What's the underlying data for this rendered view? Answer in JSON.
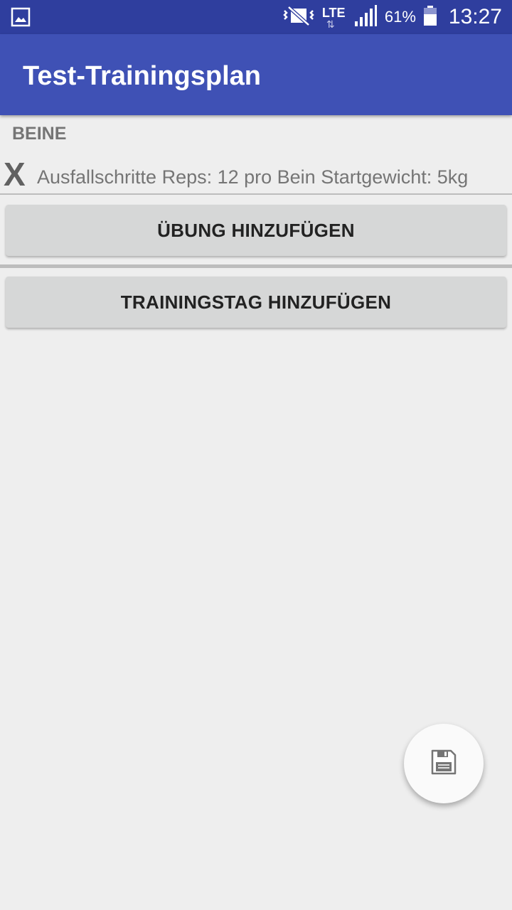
{
  "status_bar": {
    "battery_percent": "61%",
    "time": "13:27",
    "network_label": "LTE",
    "icons": [
      "image-notification-icon",
      "vibrate-mute-icon",
      "lte-data-icon",
      "signal-strength-icon",
      "battery-icon"
    ]
  },
  "app_bar": {
    "title": "Test-Trainingsplan",
    "color": "#3f51b5"
  },
  "training_day": {
    "name": "BEINE",
    "exercises": [
      {
        "delete_label": "X",
        "text": "Ausfallschritte Reps: 12 pro Bein Startgewicht: 5kg"
      }
    ],
    "add_exercise_label": "ÜBUNG HINZUFÜGEN"
  },
  "add_day_label": "TRAININGSTAG HINZUFÜGEN",
  "fab": {
    "icon": "save-icon"
  }
}
